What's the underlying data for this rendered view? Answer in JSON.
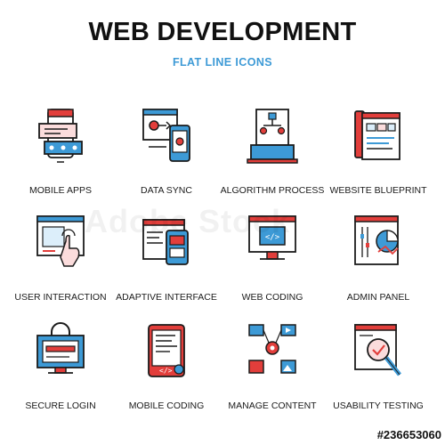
{
  "header": {
    "title": "WEB DEVELOPMENT",
    "subtitle": "FLAT LINE ICONS"
  },
  "colors": {
    "accent_blue": "#3d9ad6",
    "accent_red": "#e23e3b",
    "stroke": "#1b1b1b",
    "light_blue": "#dceefa",
    "light_red": "#fbdcdc"
  },
  "icons": [
    {
      "icon": "mobile-apps-icon",
      "label": "MOBILE APPS"
    },
    {
      "icon": "data-sync-icon",
      "label": "DATA SYNC"
    },
    {
      "icon": "algorithm-process-icon",
      "label": "ALGORITHM PROCESS"
    },
    {
      "icon": "website-blueprint-icon",
      "label": "WEBSITE BLUEPRINT"
    },
    {
      "icon": "user-interaction-icon",
      "label": "USER INTERACTION"
    },
    {
      "icon": "adaptive-interface-icon",
      "label": "ADAPTIVE INTERFACE"
    },
    {
      "icon": "web-coding-icon",
      "label": "WEB CODING"
    },
    {
      "icon": "admin-panel-icon",
      "label": "ADMIN PANEL"
    },
    {
      "icon": "secure-login-icon",
      "label": "SECURE LOGIN"
    },
    {
      "icon": "mobile-coding-icon",
      "label": "MOBILE CODING"
    },
    {
      "icon": "manage-content-icon",
      "label": "MANAGE CONTENT"
    },
    {
      "icon": "usability-testing-icon",
      "label": "USABILITY TESTING"
    }
  ],
  "watermark": "Adobe Stock",
  "stock_id": "#236653060"
}
